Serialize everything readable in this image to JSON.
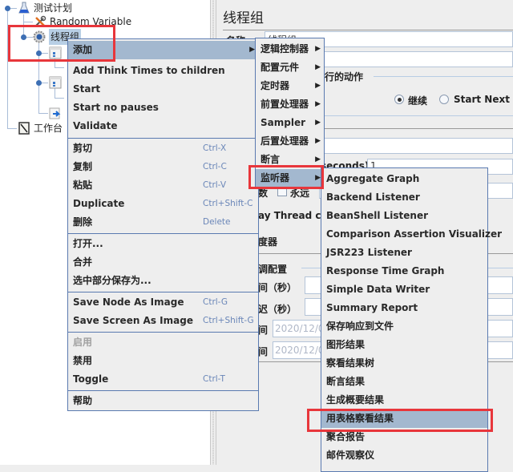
{
  "tree": {
    "nodes": [
      {
        "label": "测试计划",
        "icon": "test-plan-flask-icon"
      },
      {
        "label": "Random Variable",
        "icon": "config-element-tools-icon"
      },
      {
        "label": "线程组",
        "icon": "thread-group-gear-icon",
        "selected": true
      },
      {
        "label": "",
        "icon": "controller-icon"
      },
      {
        "label": "",
        "icon": "controller-icon"
      },
      {
        "label": "",
        "icon": "script-arrow-icon"
      },
      {
        "label": "工作台",
        "icon": "workbench-notepad-icon"
      }
    ]
  },
  "right_panel": {
    "title": "线程组",
    "name_label": "名称",
    "name_value": "线程组",
    "action_group_label": "行的动作",
    "radio_continue": "继续",
    "radio_start_next": "Start Next Th",
    "seconds_suffix": "seconds)",
    "seconds_value": "1",
    "loop_label": "数",
    "forever_label": "永远",
    "delay_thread_label": "ay Thread cre",
    "scheduler_label": "度器",
    "scheduler_config_label": "调配置",
    "duration_label": "间（秒）",
    "delay_label": "迟（秒）",
    "start_time_label": "间",
    "start_time_value": "2020/12/0",
    "end_time_label": "间",
    "end_time_value": "2020/12/0"
  },
  "context_menu": {
    "items": [
      {
        "label": "添加",
        "submenu": true,
        "highlighted": true
      },
      {
        "label": "Add Think Times to children"
      },
      {
        "label": "Start"
      },
      {
        "label": "Start no pauses"
      },
      {
        "label": "Validate"
      },
      {
        "label": "剪切",
        "shortcut": "Ctrl-X"
      },
      {
        "label": "复制",
        "shortcut": "Ctrl-C"
      },
      {
        "label": "粘贴",
        "shortcut": "Ctrl-V"
      },
      {
        "label": "Duplicate",
        "shortcut": "Ctrl+Shift-C"
      },
      {
        "label": "删除",
        "shortcut": "Delete"
      },
      {
        "label": "打开..."
      },
      {
        "label": "合并"
      },
      {
        "label": "选中部分保存为..."
      },
      {
        "label": "Save Node As Image",
        "shortcut": "Ctrl-G"
      },
      {
        "label": "Save Screen As Image",
        "shortcut": "Ctrl+Shift-G"
      },
      {
        "label": "启用",
        "disabled": true
      },
      {
        "label": "禁用"
      },
      {
        "label": "Toggle",
        "shortcut": "Ctrl-T"
      },
      {
        "label": "帮助"
      }
    ]
  },
  "add_submenu": {
    "items": [
      {
        "label": "逻辑控制器"
      },
      {
        "label": "配置元件"
      },
      {
        "label": "定时器"
      },
      {
        "label": "前置处理器"
      },
      {
        "label": "Sampler"
      },
      {
        "label": "后置处理器"
      },
      {
        "label": "断言"
      },
      {
        "label": "监听器",
        "highlighted": true
      }
    ]
  },
  "listener_submenu": {
    "items": [
      {
        "label": "Aggregate Graph"
      },
      {
        "label": "Backend Listener"
      },
      {
        "label": "BeanShell Listener"
      },
      {
        "label": "Comparison Assertion Visualizer"
      },
      {
        "label": "JSR223 Listener"
      },
      {
        "label": "Response Time Graph"
      },
      {
        "label": "Simple Data Writer"
      },
      {
        "label": "Summary Report"
      },
      {
        "label": "保存响应到文件"
      },
      {
        "label": "图形结果"
      },
      {
        "label": "察看结果树"
      },
      {
        "label": "断言结果"
      },
      {
        "label": "生成概要结果"
      },
      {
        "label": "用表格察看结果",
        "highlighted": true
      },
      {
        "label": "聚合报告"
      },
      {
        "label": "邮件观察仪"
      }
    ]
  },
  "colors": {
    "menu_highlight": "#a3b8cf",
    "menu_border": "#5a7ab0",
    "annotation_red": "#e8363b",
    "shortcut_text": "#6a86b8"
  }
}
